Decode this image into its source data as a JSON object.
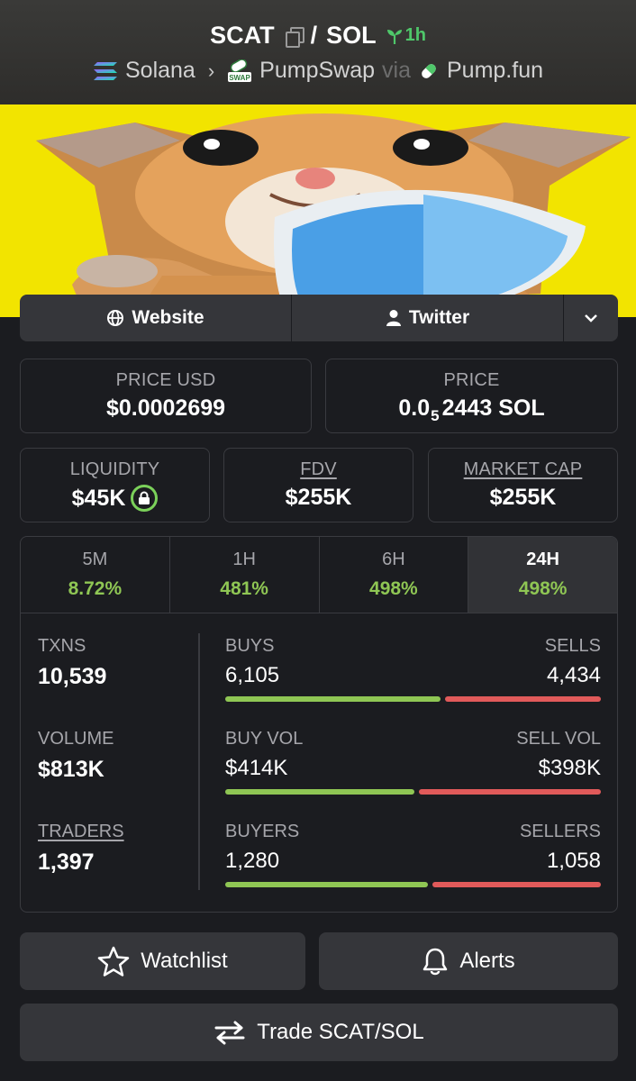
{
  "header": {
    "base": "SCAT",
    "slash": "/",
    "quote": "SOL",
    "age": "1h",
    "chain": "Solana",
    "dex": "PumpSwap",
    "via": "via",
    "launchpad": "Pump.fun",
    "swap_badge": "SWAP"
  },
  "links": {
    "website": "Website",
    "twitter": "Twitter"
  },
  "price_usd": {
    "label": "PRICE USD",
    "value": "$0.0002699"
  },
  "price": {
    "label": "PRICE",
    "prefix": "0.0",
    "zeros": "5",
    "suffix": "2443 SOL"
  },
  "liquidity": {
    "label": "LIQUIDITY",
    "value": "$45K"
  },
  "fdv": {
    "label": "FDV",
    "value": "$255K"
  },
  "market_cap": {
    "label": "MARKET CAP",
    "value": "$255K"
  },
  "tabs": [
    {
      "label": "5M",
      "value": "8.72%"
    },
    {
      "label": "1H",
      "value": "481%"
    },
    {
      "label": "6H",
      "value": "498%"
    },
    {
      "label": "24H",
      "value": "498%"
    }
  ],
  "stats": {
    "txns": {
      "label": "TXNS",
      "value": "10,539"
    },
    "volume": {
      "label": "VOLUME",
      "value": "$813K"
    },
    "traders": {
      "label": "TRADERS",
      "value": "1,397"
    },
    "buys": {
      "left_label": "BUYS",
      "right_label": "SELLS",
      "left": "6,105",
      "right": "4,434",
      "buy_fraction": 0.579
    },
    "buy_vol": {
      "left_label": "BUY VOL",
      "right_label": "SELL VOL",
      "left": "$414K",
      "right": "$398K",
      "buy_fraction": 0.51
    },
    "buyers": {
      "left_label": "BUYERS",
      "right_label": "SELLERS",
      "left": "1,280",
      "right": "1,058",
      "buy_fraction": 0.547
    }
  },
  "buttons": {
    "watchlist": "Watchlist",
    "alerts": "Alerts",
    "trade": "Trade SCAT/SOL"
  },
  "colors": {
    "positive": "#8fc654",
    "negative": "#e15a5a",
    "banner_bg": "#f2e400"
  }
}
